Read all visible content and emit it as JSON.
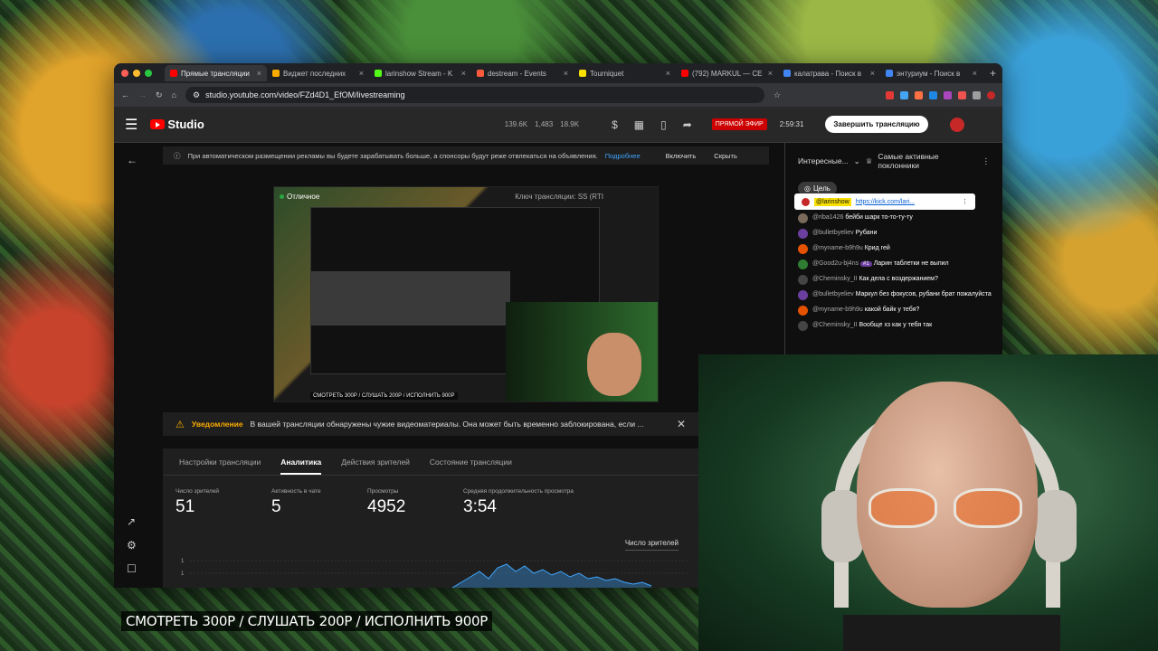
{
  "browser": {
    "tabs": [
      {
        "label": "Прямые трансляции",
        "color": "#ff0000",
        "active": true
      },
      {
        "label": "Виджет последних",
        "color": "#f9ab00"
      },
      {
        "label": "larinshow Stream - K",
        "color": "#53fc18"
      },
      {
        "label": "destream - Events",
        "color": "#ff5a3c"
      },
      {
        "label": "Tourniquet",
        "color": "#f9e000"
      },
      {
        "label": "(792) MARKUL — CE",
        "color": "#ff0000"
      },
      {
        "label": "калатрава - Поиск в",
        "color": "#4285f4"
      },
      {
        "label": "энтуриум - Поиск в",
        "color": "#4285f4"
      }
    ],
    "url": "studio.youtube.com/video/FZd4D1_EfOM/livestreaming"
  },
  "header": {
    "studio_label": "Studio",
    "stats": [
      "139.6K",
      "1,483",
      "18.9K"
    ],
    "live_badge": "ПРЯМОЙ ЭФИР",
    "live_time": "2:59:31",
    "end_button": "Завершить трансляцию"
  },
  "notice": {
    "text": "При автоматическом размещении рекламы вы будете зарабатывать больше, а спонсоры будут реже отвлекаться на объявления.",
    "link": "Подробнее",
    "enable": "Включить",
    "hide": "Скрыть"
  },
  "preview": {
    "status": "Отличное",
    "key_label": "Ключ трансляции: SS (RTI",
    "subtitle": "СМОТРЕТЬ 300Р / СЛУШАТЬ 200Р / ИСПОЛНИТЬ 900Р"
  },
  "warning": {
    "title": "Уведомление",
    "text": "В вашей трансляции обнаружены чужие видеоматериалы. Она может быть временно заблокирована, если ..."
  },
  "panel": {
    "tabs": [
      "Настройки трансляции",
      "Аналитика",
      "Действия зрителей",
      "Состояние трансляции"
    ],
    "active_tab": "Аналитика",
    "metrics": [
      {
        "label": "Число зрителей",
        "value": "51"
      },
      {
        "label": "Активность в чате",
        "value": "5"
      },
      {
        "label": "Просмотры",
        "value": "4952"
      },
      {
        "label": "Средняя продолжительность просмотра",
        "value": "3:54"
      }
    ],
    "viewers_dropdown": "Число зрителей",
    "spark_ticks": [
      "1",
      "1"
    ]
  },
  "chat": {
    "mode": "Интересные...",
    "top_fans": "Самые активные поклонники",
    "goal": "Цель",
    "pinned_user": "@larinshow",
    "pinned_link": "https://kick.com/lari...",
    "messages": [
      {
        "author": "@riba1426",
        "text": "бейби шарк то-то-ту-ту",
        "color": "#7a6a5a"
      },
      {
        "author": "@bulletbyeliev",
        "text": "Рубани",
        "color": "#6b3fa0"
      },
      {
        "author": "@myname-b9h9u",
        "text": "Крид гей",
        "color": "#e65100"
      },
      {
        "author": "@Good2u-bj4ns",
        "badge": "#1",
        "text": "Ларин таблетки не выпил",
        "color": "#2e7d32"
      },
      {
        "author": "@Cheminsky_II",
        "text": "Как дела с воздержанием?",
        "color": "#444444"
      },
      {
        "author": "@bulletbyeliev",
        "text": "Маркул без фокусов, рубани брат пожалуйста",
        "color": "#6b3fa0"
      },
      {
        "author": "@myname-b9h9u",
        "text": "какой байк у тебя?",
        "color": "#e65100"
      },
      {
        "author": "@Cheminsky_II",
        "text": "Вообще хз как у тебя так",
        "color": "#444444"
      }
    ]
  },
  "ticker": "СМОТРЕТЬ 300Р / СЛУШАТЬ 200Р / ИСПОЛНИТЬ 900Р"
}
